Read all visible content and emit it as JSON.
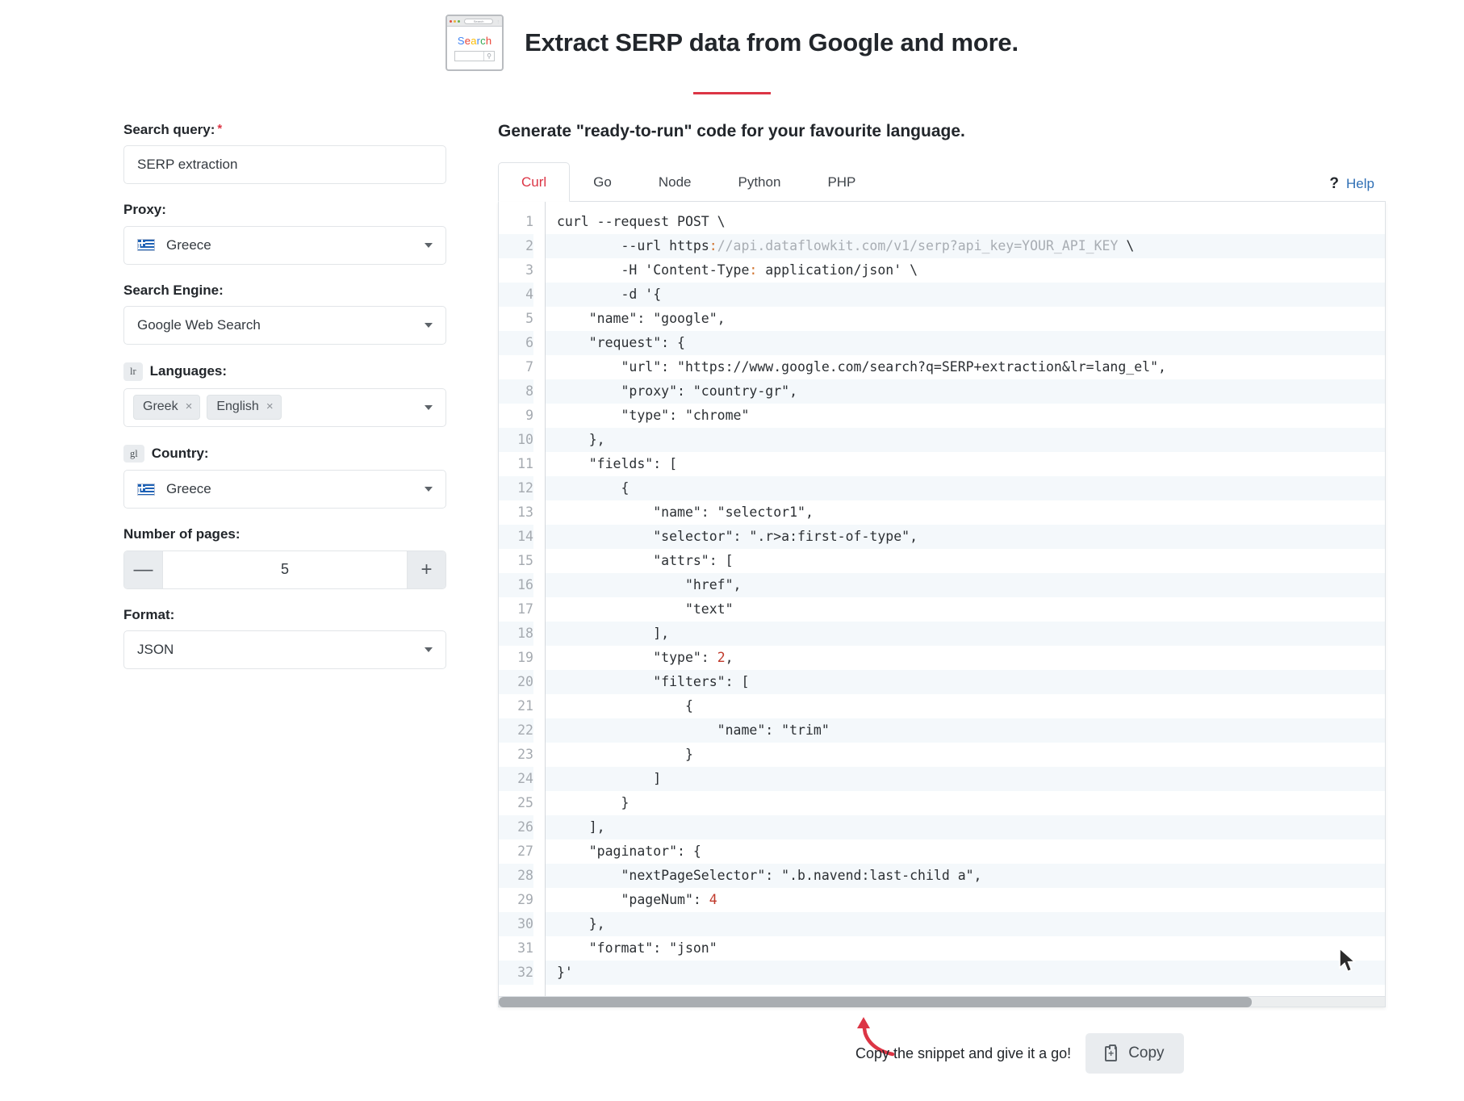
{
  "header": {
    "icon_name": "browser-search-icon",
    "icon_word": "Search",
    "title": "Extract SERP data from Google and more.",
    "accent_color": "#dc3545"
  },
  "form": {
    "search_query": {
      "label": "Search query:",
      "required_marker": "*",
      "value": "SERP extraction"
    },
    "proxy": {
      "label": "Proxy:",
      "value": "Greece",
      "flag": "greece-flag-icon"
    },
    "search_engine": {
      "label": "Search Engine:",
      "value": "Google Web Search"
    },
    "languages": {
      "badge": "lr",
      "label": "Languages:",
      "tags": [
        "Greek",
        "English"
      ],
      "remove_glyph": "×"
    },
    "country": {
      "badge": "gl",
      "label": "Country:",
      "value": "Greece",
      "flag": "greece-flag-icon"
    },
    "pages": {
      "label": "Number of pages:",
      "value": "5",
      "minus_label": "—",
      "plus_label": "+"
    },
    "format": {
      "label": "Format:",
      "value": "JSON"
    }
  },
  "code_panel": {
    "heading": "Generate \"ready-to-run\" code for your favourite language.",
    "tabs": [
      {
        "label": "Curl",
        "active": true
      },
      {
        "label": "Go",
        "active": false
      },
      {
        "label": "Node",
        "active": false
      },
      {
        "label": "Python",
        "active": false
      },
      {
        "label": "PHP",
        "active": false
      }
    ],
    "help": {
      "icon": "question-mark-icon",
      "label": "Help"
    },
    "line_count": 32,
    "lines": [
      "curl --request POST \\",
      "        --url https://api.dataflowkit.com/v1/serp?api_key=YOUR_API_KEY \\",
      "        -H 'Content-Type: application/json' \\",
      "        -d '{",
      "    \"name\": \"google\",",
      "    \"request\": {",
      "        \"url\": \"https://www.google.com/search?q=SERP+extraction&lr=lang_el\",",
      "        \"proxy\": \"country-gr\",",
      "        \"type\": \"chrome\"",
      "    },",
      "    \"fields\": [",
      "        {",
      "            \"name\": \"selector1\",",
      "            \"selector\": \".r>a:first-of-type\",",
      "            \"attrs\": [",
      "                \"href\",",
      "                \"text\"",
      "            ],",
      "            \"type\": 2,",
      "            \"filters\": [",
      "                {",
      "                    \"name\": \"trim\"",
      "                }",
      "            ]",
      "        }",
      "    ],",
      "    \"paginator\": {",
      "        \"nextPageSelector\": \".b.navend:last-child a\",",
      "        \"pageNum\": 4",
      "    },",
      "    \"format\": \"json\"",
      "}'"
    ],
    "scroll_percent": 85
  },
  "footer": {
    "hint": "Copy the snippet and give it a go!",
    "copy_label": "Copy",
    "copy_icon": "clipboard-plus-icon"
  }
}
